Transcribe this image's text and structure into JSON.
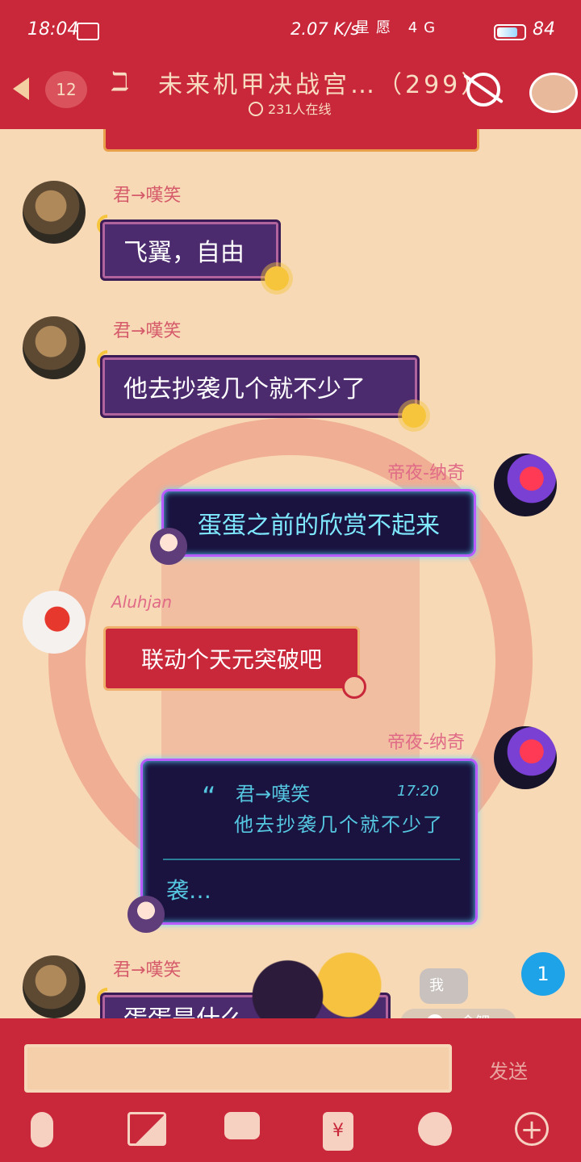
{
  "status_bar": {
    "time": "18:04",
    "speed": "2.07 K/s",
    "network_icons": "星愿 4G",
    "battery": "84",
    "battery_level_percent": 84
  },
  "header": {
    "back_badge": "12",
    "title": "未来机甲决战宫…（299）",
    "online": "231人在线"
  },
  "messages": [
    {
      "nick": "君→嘆笑",
      "text": "飞翼，自由"
    },
    {
      "nick": "君→嘆笑",
      "text": "他去抄袭几个就不少了"
    },
    {
      "nick": "帝夜-纳奇",
      "text": "蛋蛋之前的欣赏不起来"
    },
    {
      "nick": "Aluhjan",
      "text": "联动个天元突破吧"
    },
    {
      "nick": "帝夜-纳奇",
      "quote": {
        "nick": "君→嘆笑",
        "time": "17:20",
        "text": "他去抄袭几个就不少了"
      },
      "text": "袭…"
    },
    {
      "nick": "君→嘆笑",
      "text": "蛋蛋是什么"
    }
  ],
  "floating": {
    "unread": "1",
    "me": "我",
    "koi": "金鲤"
  },
  "input": {
    "send": "发送",
    "rmb_symbol": "¥"
  }
}
